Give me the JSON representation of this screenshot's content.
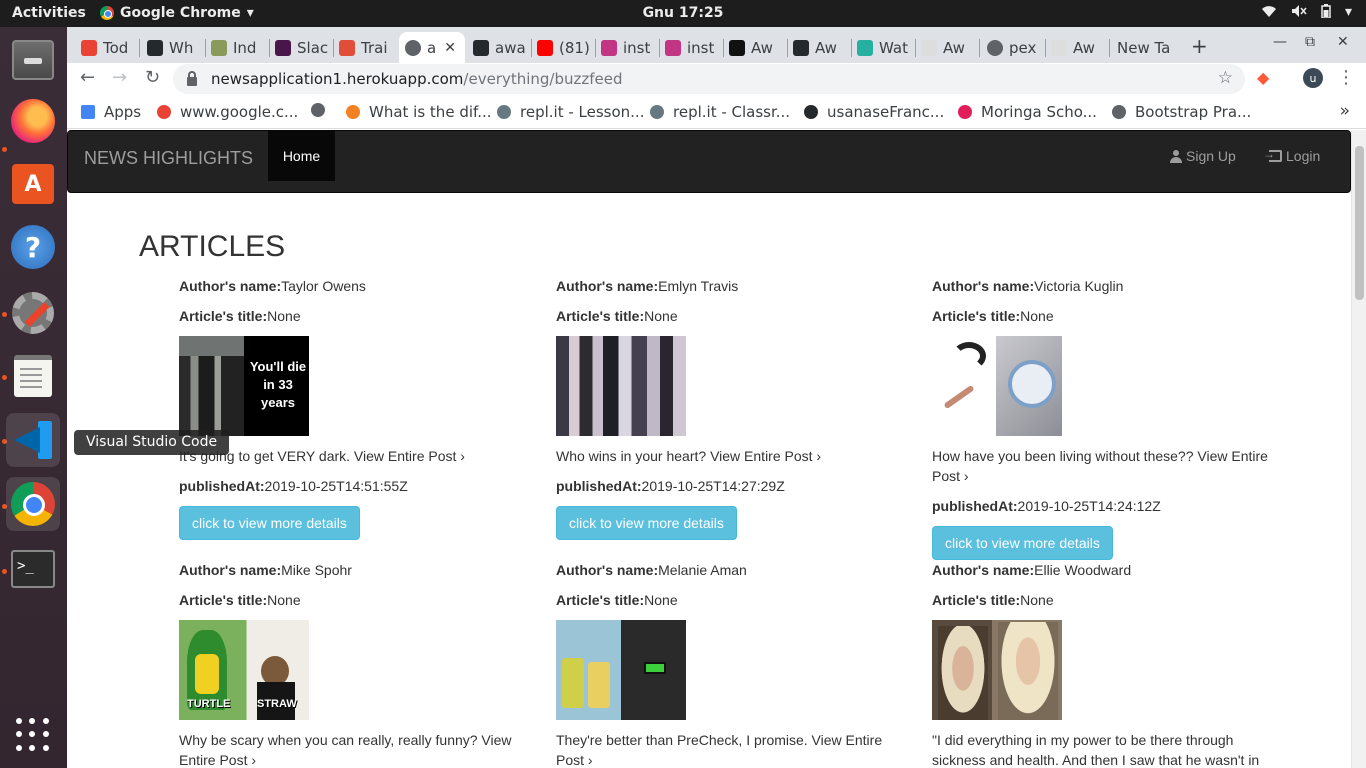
{
  "topbar": {
    "activities": "Activities",
    "app_name": "Google Chrome",
    "clock": "Gnu 17:25",
    "tray": {
      "wifi_icon": "wifi-icon",
      "volume_icon": "volume-muted-icon",
      "battery_icon": "battery-icon",
      "menu_icon": "chevron-down-icon"
    }
  },
  "dock": {
    "tooltip": "Visual Studio Code",
    "items": [
      "files",
      "firefox",
      "ubuntu-software",
      "help",
      "settings",
      "text-editor",
      "visual-studio-code",
      "google-chrome",
      "terminal",
      "show-applications"
    ]
  },
  "tabs": [
    {
      "label": "Tod",
      "icon": "gmail-icon"
    },
    {
      "label": "Wh",
      "icon": "github-icon"
    },
    {
      "label": "Ind",
      "icon": "plant-icon"
    },
    {
      "label": "Slac",
      "icon": "slack-icon"
    },
    {
      "label": "Trai",
      "icon": "training-icon"
    },
    {
      "label": "a",
      "icon": "globe-icon",
      "active": true
    },
    {
      "label": "awa",
      "icon": "github-icon"
    },
    {
      "label": "(81)",
      "icon": "youtube-icon"
    },
    {
      "label": "inst",
      "icon": "instagram-icon"
    },
    {
      "label": "inst",
      "icon": "instagram-icon"
    },
    {
      "label": "Aw",
      "icon": "awwwards-icon"
    },
    {
      "label": "Aw",
      "icon": "github-icon"
    },
    {
      "label": "Wat",
      "icon": "d-icon"
    },
    {
      "label": "Aw",
      "icon": "pexels-alt-icon"
    },
    {
      "label": "pex",
      "icon": "globe-icon"
    },
    {
      "label": "Aw",
      "icon": "pexels-alt-icon"
    },
    {
      "label": "New Ta",
      "icon": ""
    }
  ],
  "toolbar": {
    "url_host": "newsapplication1.herokuapp.com",
    "url_path": "/everything/buzzfeed",
    "profile_initial": "u"
  },
  "bookmarks": [
    {
      "label": "Apps",
      "icon": "apps-grid-icon"
    },
    {
      "label": "www.google.c...",
      "icon": "google-icon"
    },
    {
      "label": "",
      "icon": "globe-icon"
    },
    {
      "label": "What is the dif...",
      "icon": "stackoverflow-icon"
    },
    {
      "label": "repl.it - Lesson...",
      "icon": "replit-icon"
    },
    {
      "label": "repl.it - Classr...",
      "icon": "replit-icon"
    },
    {
      "label": "usanaseFranc...",
      "icon": "github-icon"
    },
    {
      "label": "Moringa Scho...",
      "icon": "moringa-icon"
    },
    {
      "label": "Bootstrap Pra...",
      "icon": "globe-icon"
    }
  ],
  "site": {
    "brand": "NEWS HIGHLIGHTS",
    "nav_home": "Home",
    "sign_up": "Sign Up",
    "login": "Login",
    "page_title": "ARTICLES",
    "author_label": "Author's name:",
    "title_label": "Article's title:",
    "published_label": "publishedAt:",
    "button_label": "click to view more details"
  },
  "articles": [
    {
      "author": "Taylor Owens",
      "title": "None",
      "thumb_text": "You'll die in 33 years",
      "description": "It's going to get VERY dark. View Entire Post ›",
      "published": "2019-10-25T14:51:55Z"
    },
    {
      "author": "Emlyn Travis",
      "title": "None",
      "description": "Who wins in your heart? View Entire Post ›",
      "published": "2019-10-25T14:27:29Z"
    },
    {
      "author": "Victoria Kuglin",
      "title": "None",
      "description": "How have you been living without these?? View Entire Post ›",
      "published": "2019-10-25T14:24:12Z"
    },
    {
      "author": "Mike Spohr",
      "title": "None",
      "thumb_labels": [
        "TURTLE",
        "STRAW"
      ],
      "description": "Why be scary when you can really, really funny? View Entire Post ›"
    },
    {
      "author": "Melanie Aman",
      "title": "None",
      "description": "They're better than PreCheck, I promise. View Entire Post ›"
    },
    {
      "author": "Ellie Woodward",
      "title": "None",
      "description": "\"I did everything in my power to be there through sickness and health. And then I saw that he wasn't in"
    }
  ]
}
